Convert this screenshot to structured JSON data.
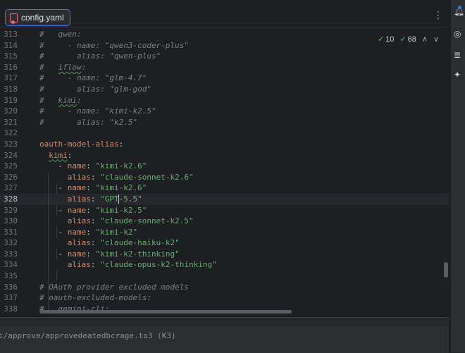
{
  "tab": {
    "filename": "config.yaml"
  },
  "inspection": {
    "warnings": "10",
    "checks": "68"
  },
  "lines": [
    {
      "n": "313",
      "segs": [
        {
          "c": "cmt",
          "t": "#   "
        },
        {
          "c": "cmt",
          "t": "qwen:"
        }
      ]
    },
    {
      "n": "314",
      "segs": [
        {
          "c": "cmt",
          "t": "#     - name: \"qwen3-coder-plus\""
        }
      ]
    },
    {
      "n": "315",
      "segs": [
        {
          "c": "cmt",
          "t": "#       alias: \"qwen-plus\""
        }
      ]
    },
    {
      "n": "316",
      "segs": [
        {
          "c": "cmt",
          "t": "#   "
        },
        {
          "c": "cmt und",
          "t": "iflow"
        },
        {
          "c": "cmt",
          "t": ":"
        }
      ]
    },
    {
      "n": "317",
      "segs": [
        {
          "c": "cmt",
          "t": "#     - name: \"glm-4.7\""
        }
      ]
    },
    {
      "n": "318",
      "segs": [
        {
          "c": "cmt",
          "t": "#       alias: \"glm-god\""
        }
      ]
    },
    {
      "n": "319",
      "segs": [
        {
          "c": "cmt",
          "t": "#   "
        },
        {
          "c": "cmt und",
          "t": "kimi"
        },
        {
          "c": "cmt",
          "t": ":"
        }
      ]
    },
    {
      "n": "320",
      "segs": [
        {
          "c": "cmt",
          "t": "#     - name: \"kimi-k2.5\""
        }
      ]
    },
    {
      "n": "321",
      "segs": [
        {
          "c": "cmt",
          "t": "#       alias: \"k2.5\""
        }
      ]
    },
    {
      "n": "322",
      "segs": []
    },
    {
      "n": "323",
      "segs": [
        {
          "c": "key",
          "t": "oauth-model-alias"
        },
        {
          "c": "punc",
          "t": ":"
        }
      ]
    },
    {
      "n": "324",
      "segs": [
        {
          "c": "punc",
          "t": "  "
        },
        {
          "c": "key und",
          "t": "kimi"
        },
        {
          "c": "punc",
          "t": ":"
        }
      ]
    },
    {
      "n": "325",
      "segs": [
        {
          "c": "punc",
          "t": "    - "
        },
        {
          "c": "key",
          "t": "name"
        },
        {
          "c": "punc",
          "t": ": "
        },
        {
          "c": "str",
          "t": "\"kimi-k2.6\""
        }
      ]
    },
    {
      "n": "326",
      "segs": [
        {
          "c": "punc",
          "t": "      "
        },
        {
          "c": "key",
          "t": "alias"
        },
        {
          "c": "punc",
          "t": ": "
        },
        {
          "c": "str",
          "t": "\"claude-sonnet-k2.6\""
        }
      ]
    },
    {
      "n": "327",
      "segs": [
        {
          "c": "punc",
          "t": "    - "
        },
        {
          "c": "key",
          "t": "name"
        },
        {
          "c": "punc",
          "t": ": "
        },
        {
          "c": "str",
          "t": "\"kimi-k2.6\""
        }
      ]
    },
    {
      "n": "328",
      "cur": true,
      "segs": [
        {
          "c": "punc",
          "t": "      "
        },
        {
          "c": "key",
          "t": "alias"
        },
        {
          "c": "punc",
          "t": ": "
        },
        {
          "c": "str",
          "t": "\"GPT"
        },
        {
          "c": "str caret",
          "t": "-5.5\""
        }
      ]
    },
    {
      "n": "329",
      "segs": [
        {
          "c": "punc",
          "t": "    - "
        },
        {
          "c": "key",
          "t": "name"
        },
        {
          "c": "punc",
          "t": ": "
        },
        {
          "c": "str",
          "t": "\"kimi-k2.5\""
        }
      ]
    },
    {
      "n": "330",
      "segs": [
        {
          "c": "punc",
          "t": "      "
        },
        {
          "c": "key",
          "t": "alias"
        },
        {
          "c": "punc",
          "t": ": "
        },
        {
          "c": "str",
          "t": "\"claude-sonnet-k2.5\""
        }
      ]
    },
    {
      "n": "331",
      "segs": [
        {
          "c": "punc",
          "t": "    - "
        },
        {
          "c": "key",
          "t": "name"
        },
        {
          "c": "punc",
          "t": ": "
        },
        {
          "c": "str",
          "t": "\"kimi-k2\""
        }
      ]
    },
    {
      "n": "332",
      "segs": [
        {
          "c": "punc",
          "t": "      "
        },
        {
          "c": "key",
          "t": "alias"
        },
        {
          "c": "punc",
          "t": ": "
        },
        {
          "c": "str",
          "t": "\"claude-haiku-k2\""
        }
      ]
    },
    {
      "n": "333",
      "segs": [
        {
          "c": "punc",
          "t": "    - "
        },
        {
          "c": "key",
          "t": "name"
        },
        {
          "c": "punc",
          "t": ": "
        },
        {
          "c": "str",
          "t": "\"kimi-k2-thinking\""
        }
      ]
    },
    {
      "n": "334",
      "segs": [
        {
          "c": "punc",
          "t": "      "
        },
        {
          "c": "key",
          "t": "alias"
        },
        {
          "c": "punc",
          "t": ": "
        },
        {
          "c": "str",
          "t": "\"claude-opus-k2-thinking\""
        }
      ]
    },
    {
      "n": "335",
      "segs": []
    },
    {
      "n": "336",
      "segs": [
        {
          "c": "cmt",
          "t": "# OAuth provider excluded models"
        }
      ]
    },
    {
      "n": "337",
      "segs": [
        {
          "c": "cmt",
          "t": "# oauth-excluded-models:"
        }
      ]
    },
    {
      "n": "338",
      "segs": [
        {
          "c": "cmt",
          "t": "#   gemini-cli:"
        }
      ]
    }
  ],
  "terminal": {
    "text": "c/approve/approvedeatedbcrage.to3 (K3)"
  },
  "icons": {
    "file": "yaml-file-icon",
    "more": "more-vertical-icon",
    "notifications": "bell-icon",
    "ai_chat": "chat-bubble-icon",
    "database": "database-icon",
    "plugin": "plugin-icon"
  },
  "colors": {
    "background": "#1e1f22",
    "tab_border": "#3574f0",
    "comment": "#7a7e85",
    "key": "#cf8e6d",
    "string": "#6aab73",
    "line_number": "#6f737a"
  }
}
